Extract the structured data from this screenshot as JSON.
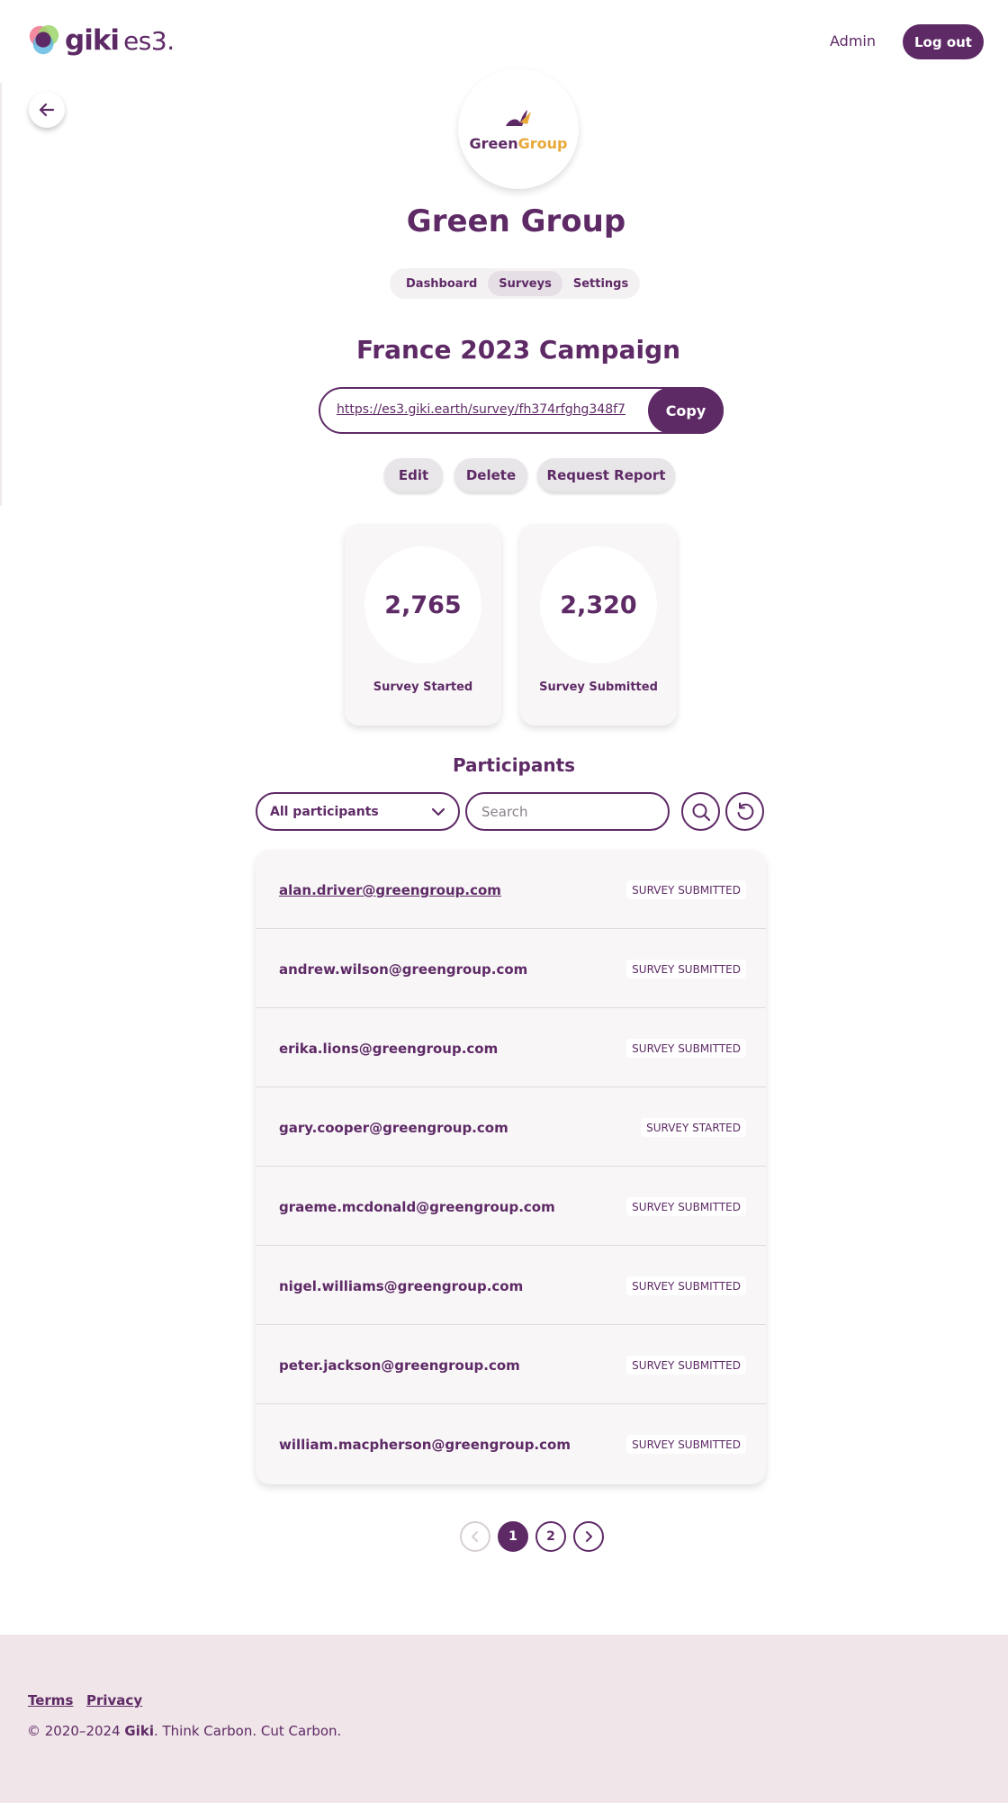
{
  "header": {
    "logo_text": "giki",
    "logo_sub": "es3.",
    "admin_label": "Admin",
    "logout_label": "Log out"
  },
  "org": {
    "logo_word1": "Green",
    "logo_word2": "Group",
    "name": "Green Group"
  },
  "tabs": [
    {
      "label": "Dashboard",
      "active": false
    },
    {
      "label": "Surveys",
      "active": true
    },
    {
      "label": "Settings",
      "active": false
    }
  ],
  "campaign": {
    "title": "France 2023 Campaign",
    "survey_url": "https://es3.giki.earth/survey/fh374rfghg348f7",
    "copy_label": "Copy",
    "edit_label": "Edit",
    "delete_label": "Delete",
    "report_label": "Request Report"
  },
  "stats": [
    {
      "value": "2,765",
      "label": "Survey Started"
    },
    {
      "value": "2,320",
      "label": "Survey Submitted"
    }
  ],
  "participants": {
    "title": "Participants",
    "filter_value": "All participants",
    "search_placeholder": "Search",
    "rows": [
      {
        "email": "alan.driver@greengroup.com",
        "status": "SURVEY SUBMITTED"
      },
      {
        "email": "andrew.wilson@greengroup.com",
        "status": "SURVEY SUBMITTED"
      },
      {
        "email": "erika.lions@greengroup.com",
        "status": "SURVEY SUBMITTED"
      },
      {
        "email": "gary.cooper@greengroup.com",
        "status": "SURVEY STARTED"
      },
      {
        "email": "graeme.mcdonald@greengroup.com",
        "status": "SURVEY SUBMITTED"
      },
      {
        "email": "nigel.williams@greengroup.com",
        "status": "SURVEY SUBMITTED"
      },
      {
        "email": "peter.jackson@greengroup.com",
        "status": "SURVEY SUBMITTED"
      },
      {
        "email": "william.macpherson@greengroup.com",
        "status": "SURVEY SUBMITTED"
      }
    ]
  },
  "pagination": {
    "pages": [
      "1",
      "2"
    ],
    "current": "1"
  },
  "footer": {
    "terms_label": "Terms",
    "privacy_label": "Privacy",
    "copyright_prefix": "© 2020–2024 ",
    "brand": "Giki",
    "tagline": ". Think Carbon. Cut Carbon."
  },
  "colors": {
    "brand_purple": "#5e2a66",
    "brand_orange": "#e8a93a",
    "footer_bg": "#f0e5e8"
  },
  "icons": {
    "back": "arrow-left-icon",
    "dropdown": "chevron-down-icon",
    "search": "search-icon",
    "reset": "refresh-icon",
    "prev": "chevron-left-icon",
    "next": "chevron-right-icon"
  }
}
